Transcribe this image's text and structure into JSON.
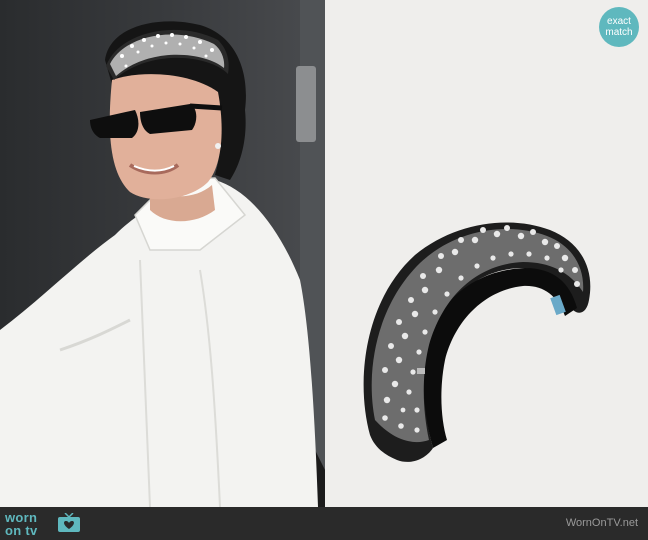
{
  "badge": {
    "line1": "exact",
    "line2": "match"
  },
  "footer": {
    "logo_top": "worn",
    "logo_bottom": "on tv",
    "logo_icon": "tv-heart-icon",
    "site_name": "WornOnTV.net"
  },
  "colors": {
    "accent": "#5fb8be",
    "footer_bg": "#2a2a2a",
    "product_bg": "#efeeec"
  }
}
